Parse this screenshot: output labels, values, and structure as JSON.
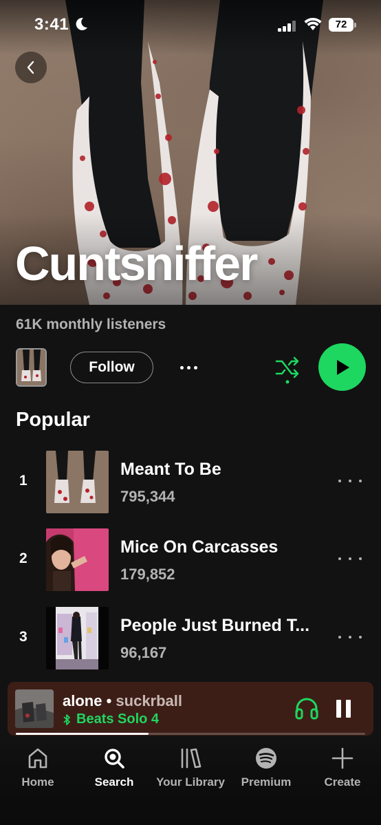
{
  "status_bar": {
    "time": "3:41",
    "battery": "72"
  },
  "artist": {
    "name": "Cuntsniffer",
    "monthly_listeners": "61K monthly listeners"
  },
  "actions": {
    "follow_label": "Follow"
  },
  "popular": {
    "title": "Popular",
    "tracks": [
      {
        "rank": "1",
        "title": "Meant To Be",
        "plays": "795,344"
      },
      {
        "rank": "2",
        "title": "Mice On Carcasses",
        "plays": "179,852"
      },
      {
        "rank": "3",
        "title": "People Just Burned T...",
        "plays": "96,167"
      }
    ]
  },
  "now_playing": {
    "title": "alone",
    "separator": " • ",
    "artist": "suckrball",
    "device": "Beats Solo 4",
    "progress": 0.38
  },
  "tabs": [
    {
      "label": "Home",
      "icon": "home-icon"
    },
    {
      "label": "Search",
      "icon": "search-icon"
    },
    {
      "label": "Your Library",
      "icon": "library-icon"
    },
    {
      "label": "Premium",
      "icon": "spotify-icon"
    },
    {
      "label": "Create",
      "icon": "plus-icon"
    }
  ],
  "colors": {
    "accent": "#1ed760",
    "background": "#121212",
    "mini_player": "#3d1e17"
  }
}
